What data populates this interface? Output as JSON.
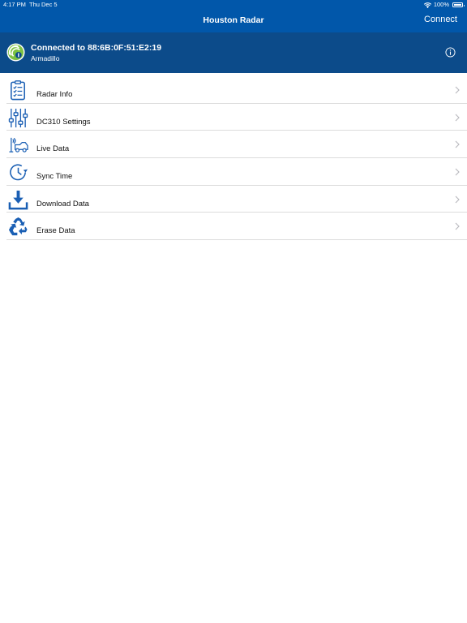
{
  "status_bar": {
    "time": "4:17 PM",
    "date": "Thu Dec 5",
    "battery": "100%"
  },
  "nav": {
    "title": "Houston Radar",
    "connect_label": "Connect"
  },
  "connection": {
    "title": "Connected to 88:6B:0F:51:E2:19",
    "device_name": "Armadillo"
  },
  "menu": [
    {
      "label": "Radar Info",
      "icon": "clipboard-checklist-icon"
    },
    {
      "label": "DC310 Settings",
      "icon": "sliders-icon"
    },
    {
      "label": "Live Data",
      "icon": "car-radar-icon"
    },
    {
      "label": "Sync Time",
      "icon": "clock-sync-icon"
    },
    {
      "label": "Download Data",
      "icon": "download-tray-icon"
    },
    {
      "label": "Erase Data",
      "icon": "recycle-icon"
    }
  ],
  "colors": {
    "nav_blue": "#0157aa",
    "banner_blue": "#0c4b8a",
    "icon_blue": "#1a5fb4"
  }
}
